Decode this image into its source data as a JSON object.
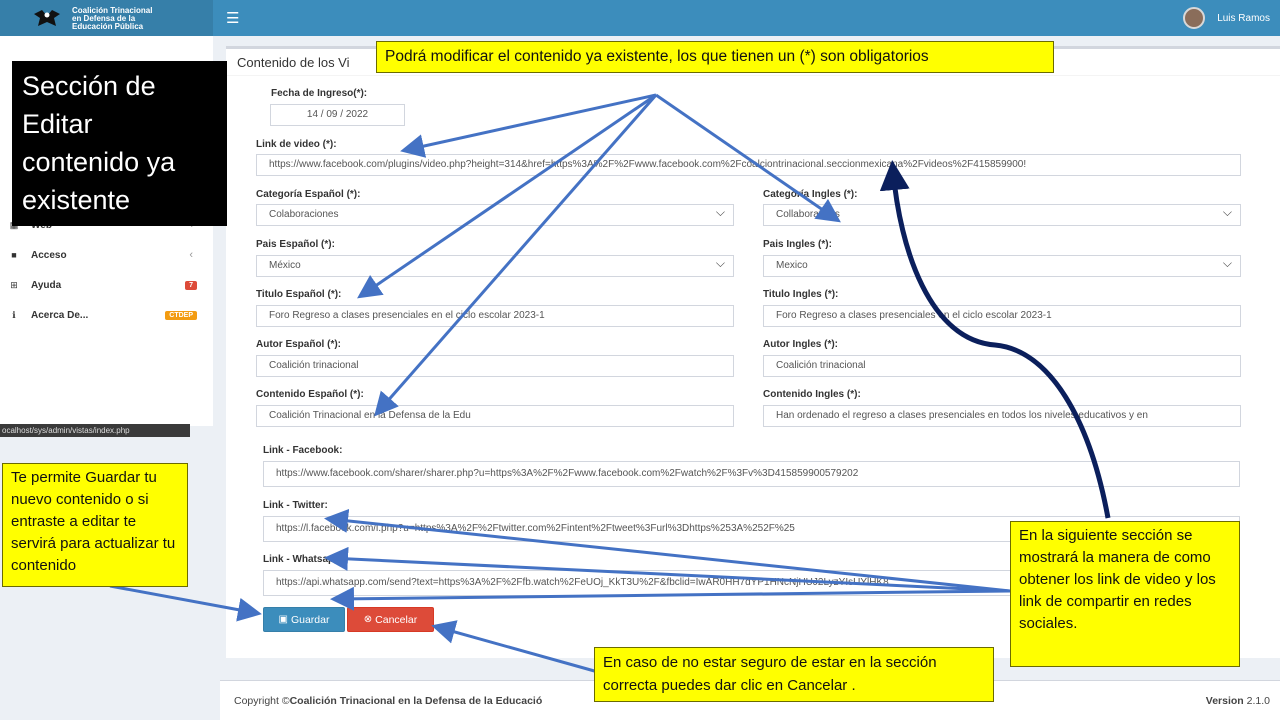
{
  "app": {
    "logo_lines": [
      "Coalición Trinacional",
      "en Defensa de la",
      "Educación Pública"
    ],
    "user_name": "Luis Ramos"
  },
  "sidebar": {
    "items": [
      {
        "label": "Web",
        "icon": "table-icon",
        "suffix": "‹"
      },
      {
        "label": "Acceso",
        "icon": "folder-icon",
        "suffix": "‹"
      },
      {
        "label": "Ayuda",
        "icon": "plus-square-icon",
        "badge": "7",
        "badge_color": "#dd4b39"
      },
      {
        "label": "Acerca De...",
        "icon": "info-circle-icon",
        "badge": "CTDEP",
        "badge_color": "#f39c12"
      }
    ],
    "status_url": "ocalhost/sys/admin/vistas/index.php"
  },
  "form": {
    "box_title": "Contenido de los Vi",
    "fecha_label": "Fecha de Ingreso(*):",
    "fecha_value": "14 / 09 / 2022",
    "video_label": "Link de video (*):",
    "video_value": "https://www.facebook.com/plugins/video.php?height=314&href=https%3A%2F%2Fwww.facebook.com%2Fcoalciontrinacional.seccionmexicana%2Fvideos%2F415859900!",
    "cat_es_label": "Categoría Español (*):",
    "cat_es_value": "Colaboraciones",
    "cat_en_label": "Categoría Ingles (*):",
    "cat_en_value": "Collaborations",
    "pais_es_label": "Pais Español (*):",
    "pais_es_value": "México",
    "pais_en_label": "Pais Ingles (*):",
    "pais_en_value": "Mexico",
    "titulo_es_label": "Titulo Español (*):",
    "titulo_es_value": "Foro Regreso a clases presenciales en el ciclo escolar 2023-1",
    "titulo_en_label": "Titulo Ingles (*):",
    "titulo_en_value": "Foro Regreso a clases presenciales en el ciclo escolar 2023-1",
    "autor_es_label": "Autor Español (*):",
    "autor_es_value": "Coalición trinacional",
    "autor_en_label": "Autor Ingles (*):",
    "autor_en_value": "Coalición trinacional",
    "cont_es_label": "Contenido Español (*):",
    "cont_es_value": "Coalición Trinacional en la Defensa de la Edu",
    "cont_en_label": "Contenido Ingles (*):",
    "cont_en_value": "Han ordenado el regreso a clases presenciales en todos los niveles educativos y en",
    "fb_label": "Link - Facebook:",
    "fb_value": "https://www.facebook.com/sharer/sharer.php?u=https%3A%2F%2Fwww.facebook.com%2Fwatch%2F%3Fv%3D415859900579202",
    "tw_label": "Link - Twitter:",
    "tw_value": "https://l.facebook.com/l.php?u=https%3A%2F%2Ftwitter.com%2Fintent%2Ftweet%3Furl%3Dhttps%253A%252F%25",
    "wa_label": "Link - Whatsapp:",
    "wa_value": "https://api.whatsapp.com/send?text=https%3A%2F%2Ffb.watch%2FeUOj_KkT3U%2F&fbclid=IwAR0HH7dYP1HNcNjHUJ2LyzYIsUYlHK8",
    "save_label": "Guardar",
    "cancel_label": "Cancelar"
  },
  "footer": {
    "copyright": "Copyright ©",
    "org": "Coalición Trinacional en la Defensa de la Educació",
    "version_label": "Version",
    "version_value": "2.1.0"
  },
  "callouts": {
    "section_title": "Sección de Editar contenido ya existente",
    "top": "Podrá modificar el contenido ya existente, los que tienen un (*) son obligatorios",
    "left": "Te permite Guardar tu nuevo contenido o si entraste a editar te servirá para actualizar tu contenido",
    "right": "En la siguiente sección se mostrará la manera de como obtener los link de video y los link de compartir en redes sociales.",
    "bottom": "En caso de no estar seguro de estar en la sección correcta puedes dar clic en Cancelar ."
  },
  "colors": {
    "header": "#3c8dbc",
    "logo_bg": "#367fa9",
    "save": "#3c8dbc",
    "cancel": "#dd4b39",
    "callout_yellow": "#ffff00",
    "arrow_blue": "#4472c4",
    "arrow_navy": "#0b1f5c"
  }
}
